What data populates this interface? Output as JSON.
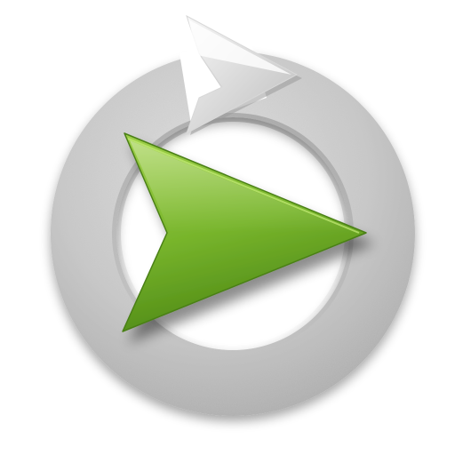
{
  "icon": {
    "name": "replay-play-app-icon",
    "ring_name": "refresh-ring-icon",
    "play_name": "play-arrow-icon"
  },
  "colors": {
    "background": "#ffffff",
    "ring_light": "#e3e3e3",
    "ring_mid": "#c9c9c9",
    "ring_dark": "#a9a9a9",
    "arrow_light": "#9fd048",
    "arrow_mid": "#78b52c",
    "arrow_dark": "#4f8a16"
  }
}
